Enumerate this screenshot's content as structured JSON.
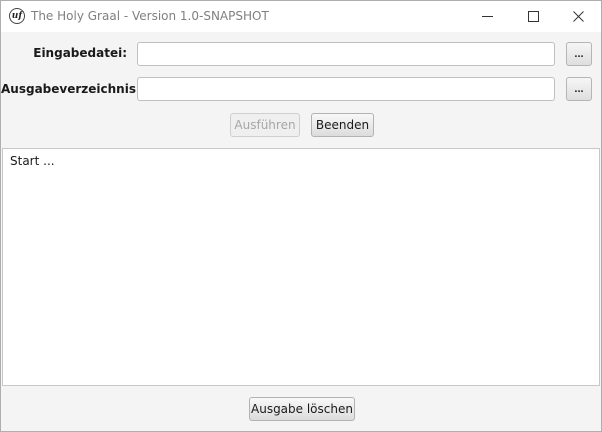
{
  "window": {
    "title": "The Holy Graal - Version 1.0-SNAPSHOT",
    "icon": "app-logo-icon",
    "icon_text": "uf"
  },
  "form": {
    "input_label": "Eingabedatei:",
    "input_value": "",
    "output_label": "Ausgabeverzeichnis:",
    "output_value": "",
    "browse_label": "..."
  },
  "actions": {
    "run_label": "Ausführen",
    "exit_label": "Beenden"
  },
  "output": {
    "text": "Start ..."
  },
  "footer": {
    "clear_label": "Ausgabe löschen"
  }
}
